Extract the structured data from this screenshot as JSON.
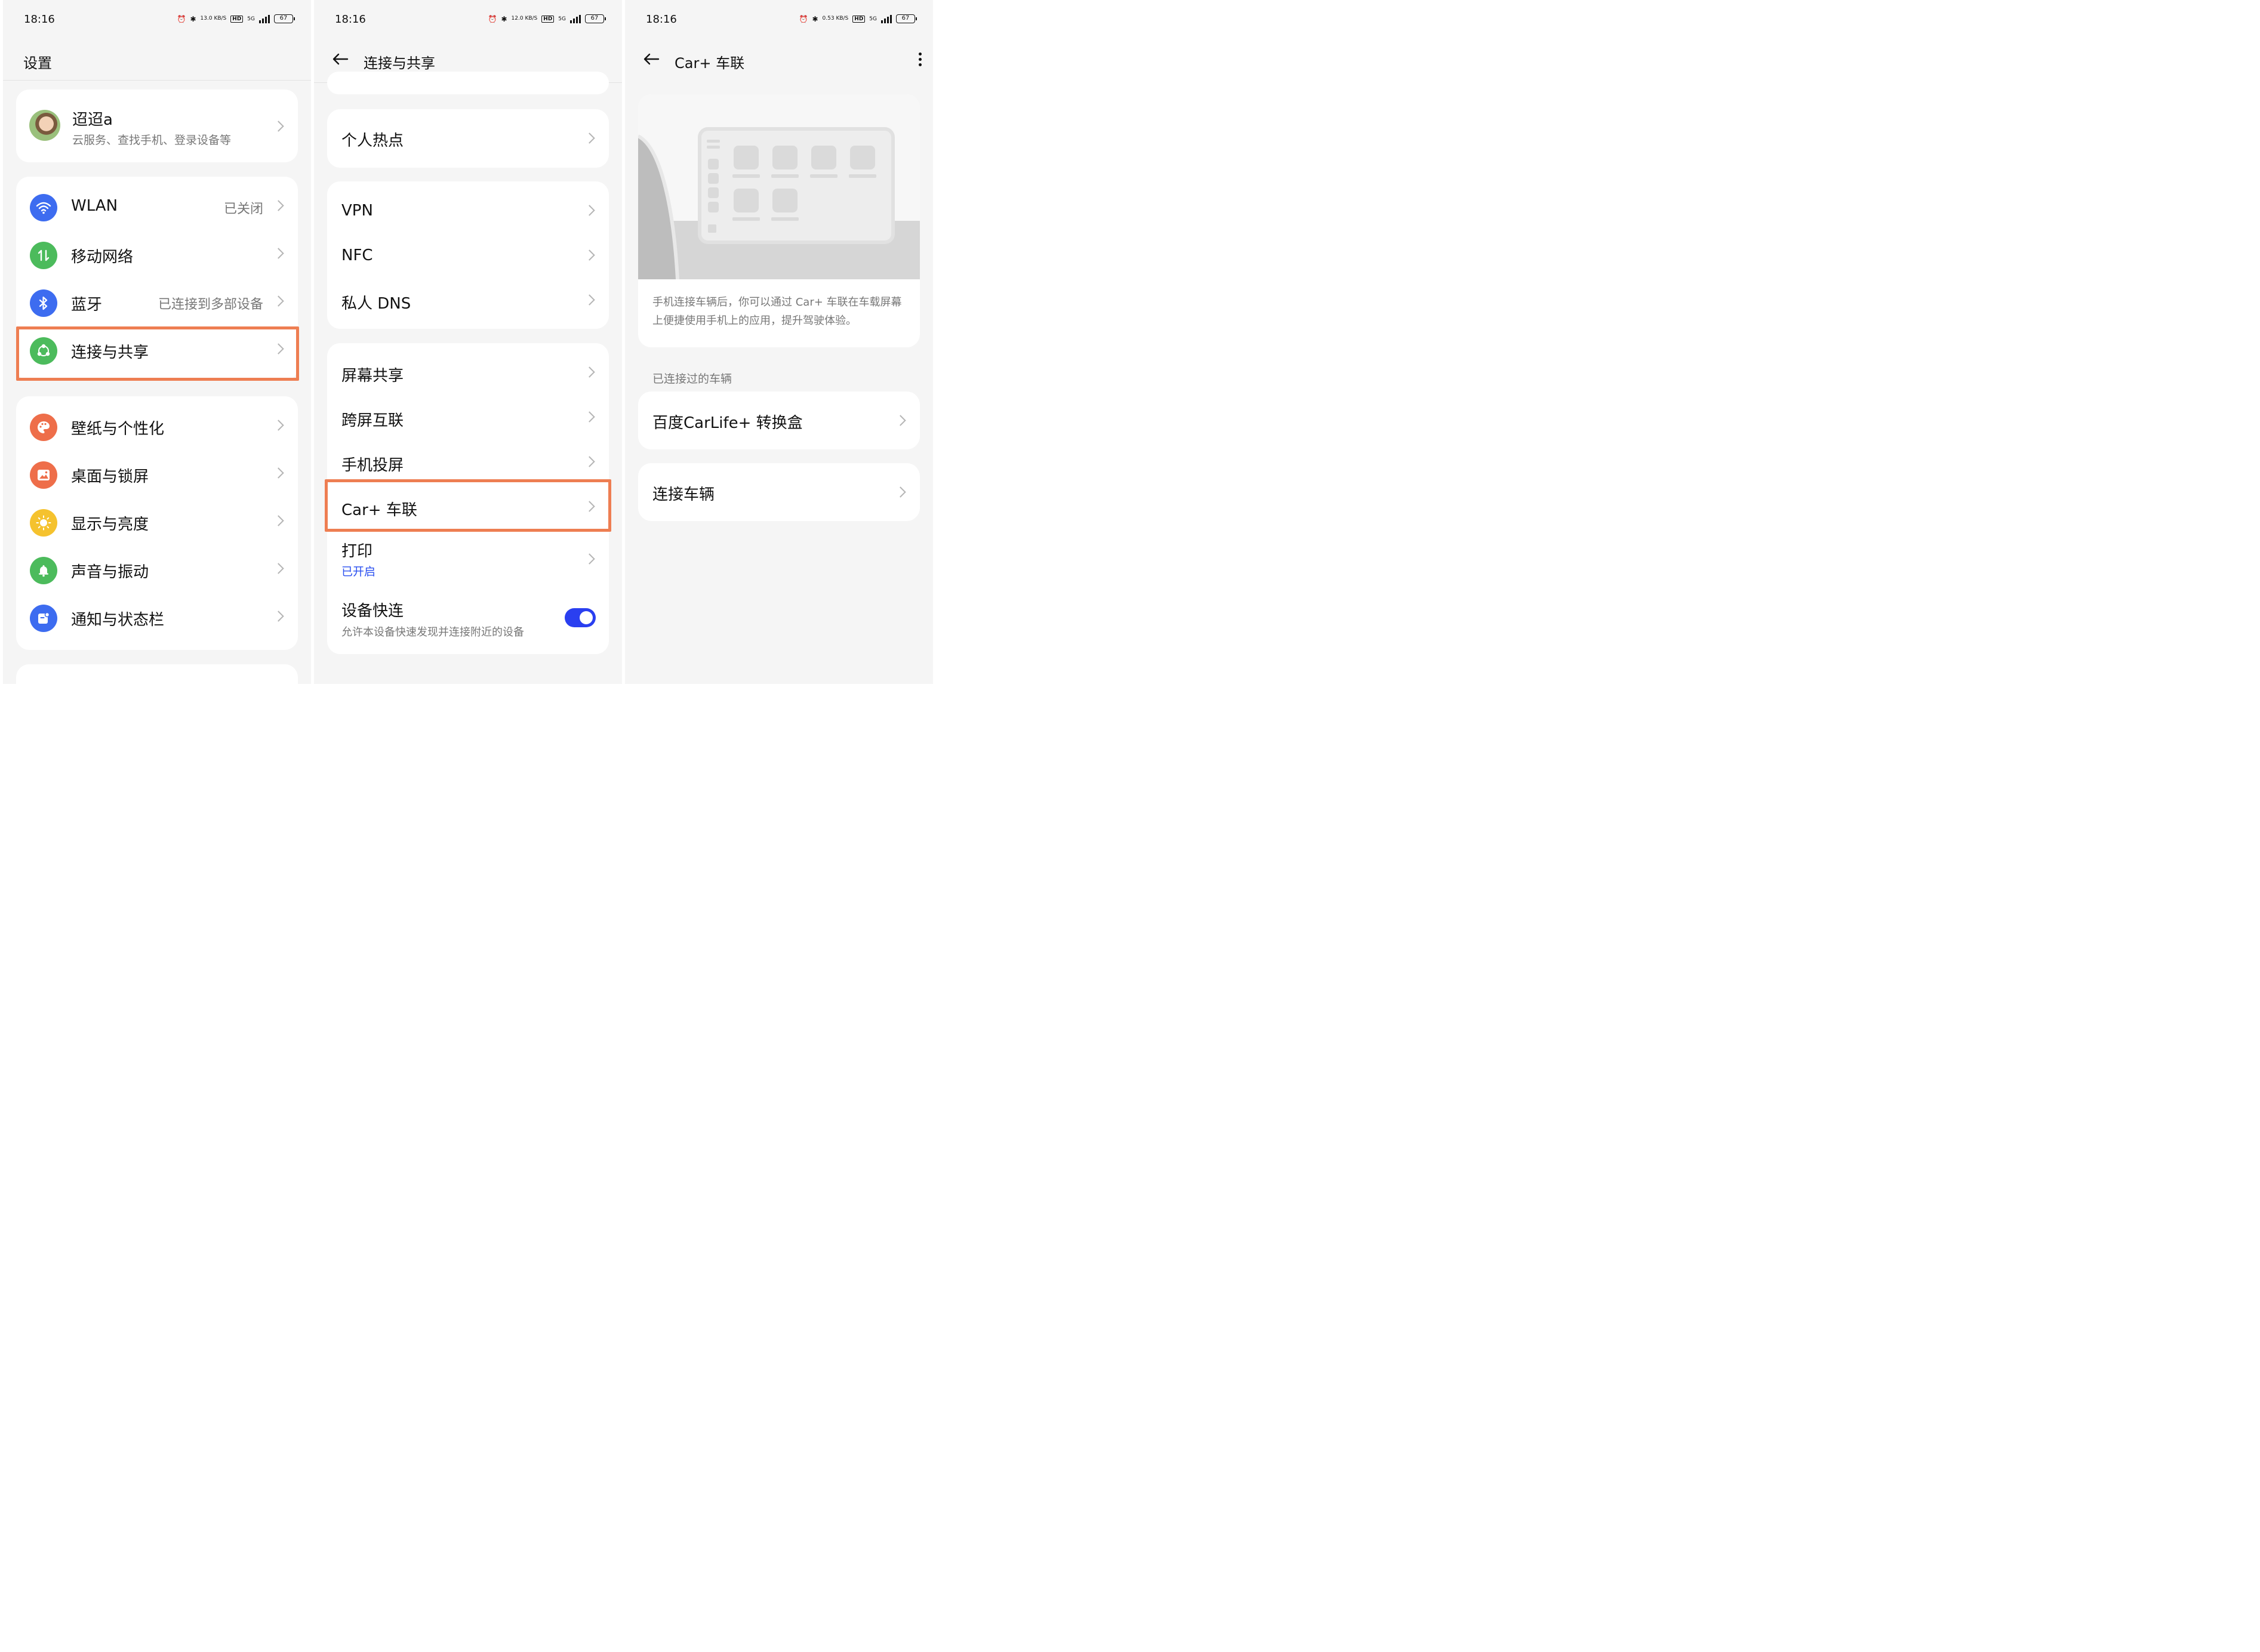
{
  "status": {
    "time": "18:16",
    "speeds": [
      "13.0 KB/S",
      "12.0 KB/S",
      "0.53 KB/S"
    ],
    "hd": "HD",
    "net": "5G",
    "battery": "67"
  },
  "panel1": {
    "title": "设置",
    "account": {
      "name": "迢迢a",
      "subtitle": "云服务、查找手机、登录设备等"
    },
    "group1": [
      {
        "label": "WLAN",
        "value": "已关闭",
        "icon": "wifi-icon",
        "color": "#3d6cf0"
      },
      {
        "label": "移动网络",
        "value": "",
        "icon": "mobile-data-icon",
        "color": "#4cbb5c"
      },
      {
        "label": "蓝牙",
        "value": "已连接到多部设备",
        "icon": "bluetooth-icon",
        "color": "#3d6cf0"
      },
      {
        "label": "连接与共享",
        "value": "",
        "icon": "share-icon",
        "color": "#4cbb5c"
      }
    ],
    "group2": [
      {
        "label": "壁纸与个性化",
        "icon": "palette-icon",
        "color": "#ee6e4a"
      },
      {
        "label": "桌面与锁屏",
        "icon": "image-icon",
        "color": "#ee6e4a"
      },
      {
        "label": "显示与亮度",
        "icon": "sun-icon",
        "color": "#f5c22e"
      },
      {
        "label": "声音与振动",
        "icon": "bell-icon",
        "color": "#4cbb5c"
      },
      {
        "label": "通知与状态栏",
        "icon": "notification-icon",
        "color": "#3d6cf0"
      }
    ]
  },
  "panel2": {
    "title": "连接与共享",
    "hotspot": "个人热点",
    "group1": [
      "VPN",
      "NFC",
      "私人 DNS"
    ],
    "group2": [
      "屏幕共享",
      "跨屏互联",
      "手机投屏",
      "Car+ 车联"
    ],
    "print": {
      "label": "打印",
      "status": "已开启"
    },
    "quick": {
      "label": "设备快连",
      "desc": "允许本设备快速发现并连接附近的设备",
      "on": true
    }
  },
  "panel3": {
    "title": "Car+ 车联",
    "description": "手机连接车辆后，你可以通过 Car+ 车联在车载屏幕上便捷使用手机上的应用，提升驾驶体验。",
    "section_label": "已连接过的车辆",
    "vehicle": "百度CarLife+ 转换盒",
    "connect": "连接车辆"
  },
  "colors": {
    "highlight": "#ee7e52",
    "accent_blue": "#2a3ff0",
    "link_blue": "#2a4ff0"
  }
}
